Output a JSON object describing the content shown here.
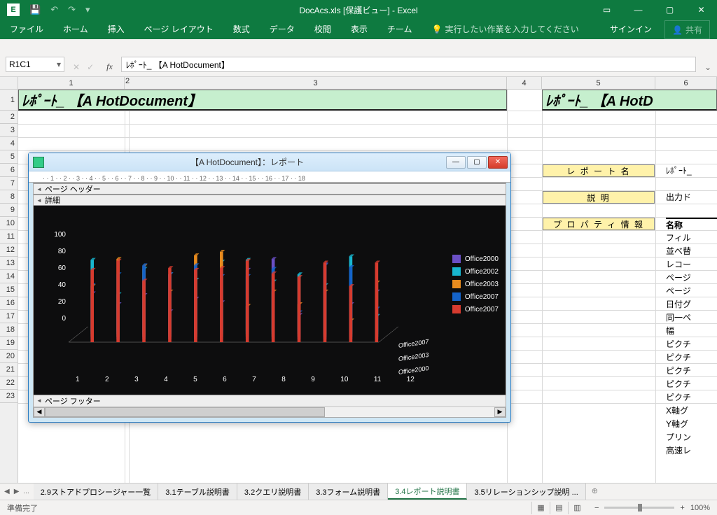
{
  "title_bar": {
    "title": "DocAcs.xls  [保護ビュー] - Excel"
  },
  "qat": {
    "app": "E"
  },
  "ribbon": {
    "tabs": [
      "ファイル",
      "ホーム",
      "挿入",
      "ページ レイアウト",
      "数式",
      "データ",
      "校閲",
      "表示",
      "チーム"
    ],
    "tell_me": "実行したい作業を入力してください",
    "signin": "サインイン",
    "share": "共有"
  },
  "formula": {
    "name_box": "R1C1",
    "value": "ﾚﾎﾟｰﾄ_ 【A HotDocument】"
  },
  "columns": {
    "c1": "1",
    "c2": "2",
    "c3": "3",
    "c4": "4",
    "c5": "5",
    "c6": "6"
  },
  "merged": {
    "title1": "ﾚﾎﾟｰﾄ_ 【A HotDocument】",
    "title2": "ﾚﾎﾟｰﾄ_ 【A HotD"
  },
  "tags": {
    "t1": "レ ポ ー ト 名",
    "t2": "説    明",
    "t3": "プ ロ パ テ ィ 情 報"
  },
  "col6": {
    "r3": "ﾚﾎﾟｰﾄ_",
    "r5": "出力ド",
    "r7": "名称",
    "items": [
      "フィル",
      "並べ替",
      "レコー",
      "ページ",
      "ページ",
      "日付グ",
      "同一ペ",
      "幅",
      "ピクチ",
      "ピクチ",
      "ピクチ",
      "ピクチ",
      "ピクチ",
      "X軸グ",
      "Y軸グ",
      "プリン",
      "高速レ"
    ]
  },
  "report": {
    "title": "【A HotDocument】：レポート",
    "header": "ページ ヘッダー",
    "detail": "詳細",
    "footer": "ページ フッター"
  },
  "chart_data": {
    "type": "bar",
    "title": "",
    "xlabel": "",
    "ylabel": "",
    "ylim": [
      0,
      100
    ],
    "yticks": [
      0,
      20,
      40,
      60,
      80,
      100
    ],
    "categories": [
      "1",
      "2",
      "3",
      "4",
      "5",
      "6",
      "7",
      "8",
      "9",
      "10",
      "11",
      "12"
    ],
    "depth_categories": [
      "Office2000",
      "Office2003",
      "Office2007"
    ],
    "series": [
      {
        "name": "Office2000",
        "color": "#6a4fc5",
        "values": [
          42,
          30,
          40,
          22,
          36,
          32,
          68,
          80,
          18,
          74,
          30,
          44
        ]
      },
      {
        "name": "Office2002",
        "color": "#18b6cf",
        "values": [
          82,
          44,
          72,
          66,
          60,
          80,
          82,
          58,
          66,
          54,
          86,
          20
        ]
      },
      {
        "name": "Office2003",
        "color": "#e88b1e",
        "values": [
          56,
          86,
          78,
          50,
          90,
          94,
          34,
          50,
          36,
          50,
          18,
          60
        ]
      },
      {
        "name": "Office2007",
        "color": "#1463c9",
        "values": [
          60,
          72,
          82,
          72,
          82,
          70,
          70,
          78,
          30,
          82,
          80,
          34
        ]
      },
      {
        "name": "Office2007",
        "color": "#d63b2f",
        "values": [
          80,
          90,
          68,
          82,
          80,
          82,
          90,
          76,
          72,
          88,
          62,
          88
        ]
      }
    ]
  },
  "sheets": {
    "nav_dots": "...",
    "tabs": [
      {
        "label": "2.9ストアドプロシージャー一覧",
        "active": false
      },
      {
        "label": "3.1テーブル説明書",
        "active": false
      },
      {
        "label": "3.2クエリ説明書",
        "active": false
      },
      {
        "label": "3.3フォーム説明書",
        "active": false
      },
      {
        "label": "3.4レポート説明書",
        "active": true
      },
      {
        "label": "3.5リレーションシップ説明 ...",
        "active": false
      }
    ]
  },
  "status": {
    "ready": "準備完了",
    "zoom": "100%"
  }
}
